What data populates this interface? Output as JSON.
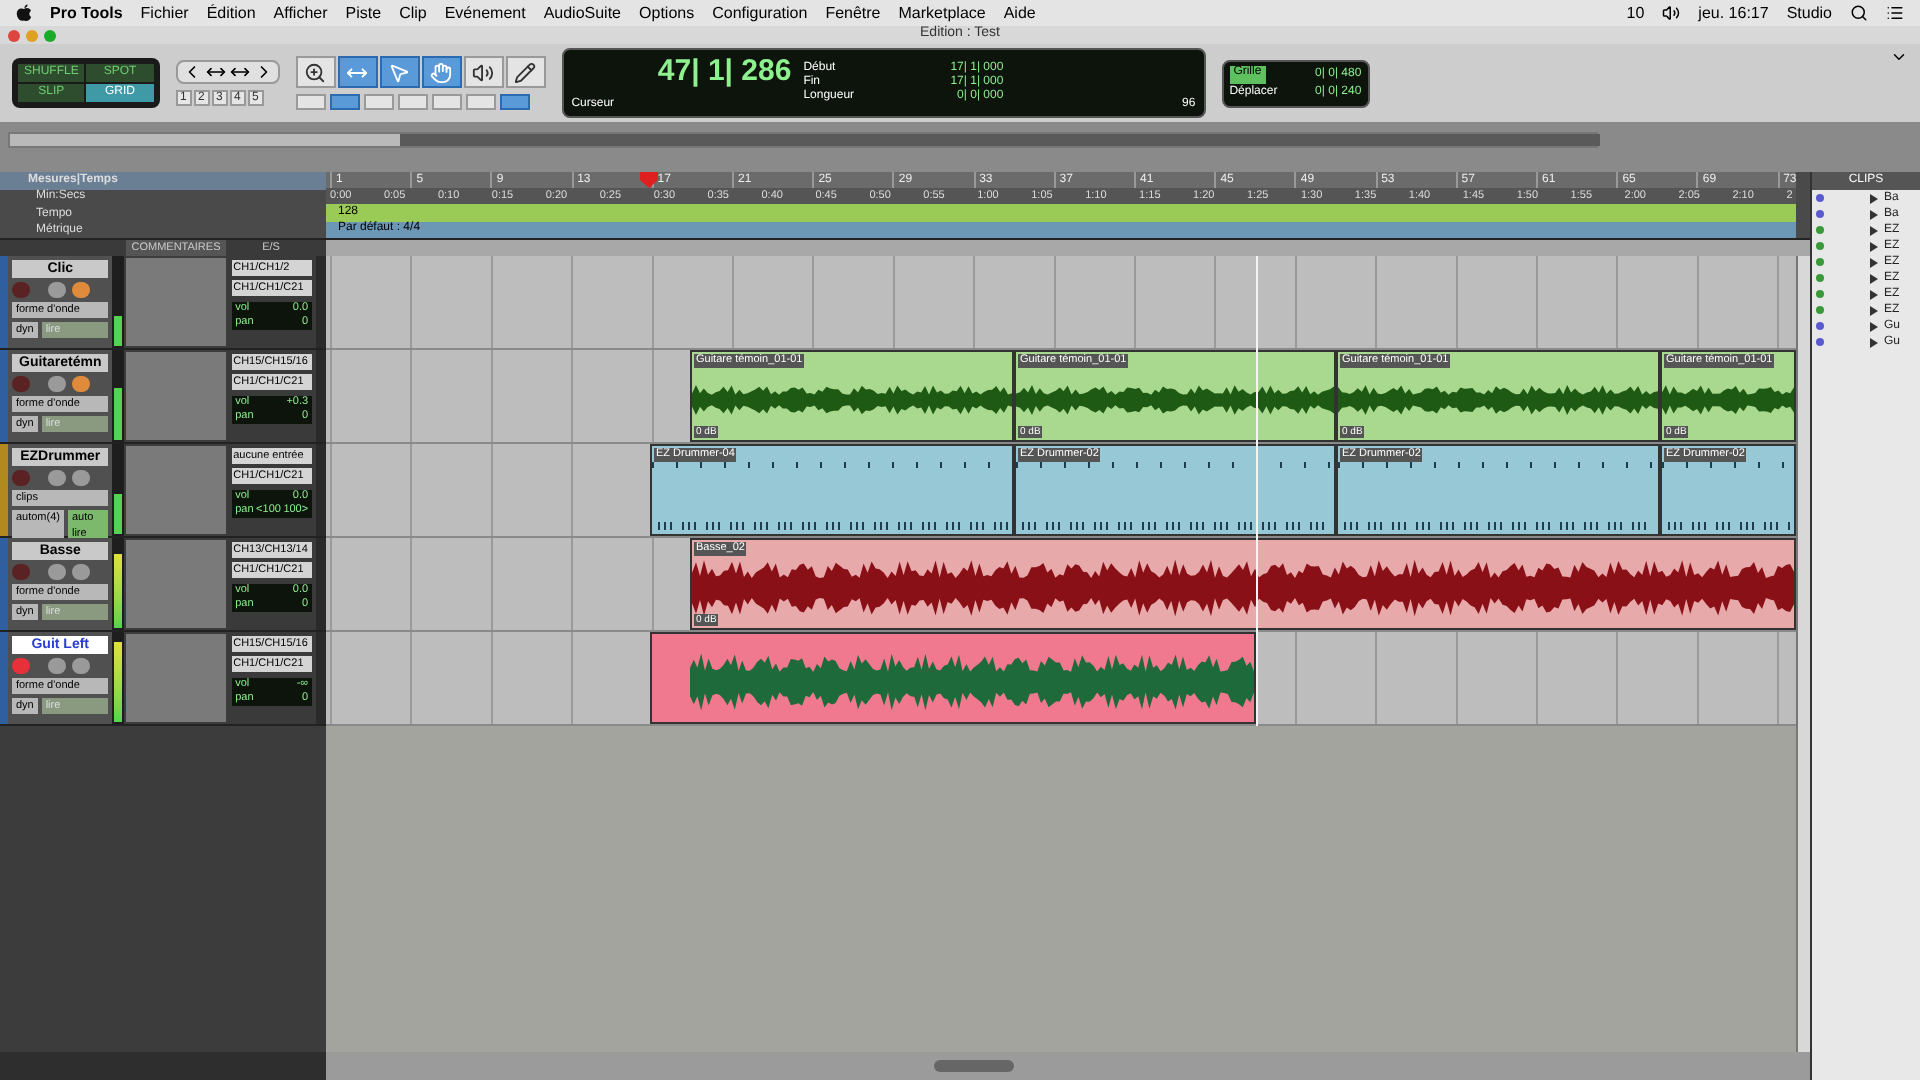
{
  "menubar": {
    "app": "Pro Tools",
    "menus": [
      "Fichier",
      "Édition",
      "Afficher",
      "Piste",
      "Clip",
      "Evénement",
      "AudioSuite",
      "Options",
      "Configuration",
      "Fenêtre",
      "Marketplace",
      "Aide"
    ],
    "status": [
      "10",
      "jeu. 16:17",
      "Studio"
    ]
  },
  "window": {
    "title": "Edition : Test"
  },
  "edit_modes": [
    {
      "label": "SHUFFLE",
      "selected": false
    },
    {
      "label": "SPOT",
      "selected": false
    },
    {
      "label": "SLIP",
      "selected": false
    },
    {
      "label": "GRID",
      "selected": true
    }
  ],
  "zoom_presets": [
    "1",
    "2",
    "3",
    "4",
    "5"
  ],
  "tools": [
    {
      "kind": "zoom",
      "selected": false
    },
    {
      "kind": "trim",
      "selected": true
    },
    {
      "kind": "select",
      "selected": true
    },
    {
      "kind": "grab",
      "selected": true
    },
    {
      "kind": "scrub",
      "selected": false
    },
    {
      "kind": "pencil",
      "selected": false
    }
  ],
  "counter": {
    "main": "47| 1| 286",
    "label": "Curseur",
    "fields": [
      {
        "label": "Début",
        "value": "17| 1| 000"
      },
      {
        "label": "Fin",
        "value": "17| 1| 000"
      },
      {
        "label": "Longueur",
        "value": "0| 0| 000"
      }
    ],
    "nudge": "96"
  },
  "grid": {
    "grid_label": "Grille",
    "grid_value": "0| 0| 480",
    "nudge_label": "Déplacer",
    "nudge_value": "0| 0| 240"
  },
  "rulers": {
    "labels": [
      "Mesures|Temps",
      "Min:Secs",
      "Tempo",
      "Métrique"
    ],
    "bars": [
      "1",
      "5",
      "9",
      "13",
      "17",
      "21",
      "25",
      "29",
      "33",
      "37",
      "41",
      "45",
      "49",
      "53",
      "57",
      "61",
      "65",
      "69",
      "73"
    ],
    "times": [
      "0:00",
      "0:05",
      "0:10",
      "0:15",
      "0:20",
      "0:25",
      "0:30",
      "0:35",
      "0:40",
      "0:45",
      "0:50",
      "0:55",
      "1:00",
      "1:05",
      "1:10",
      "1:15",
      "1:20",
      "1:25",
      "1:30",
      "1:35",
      "1:40",
      "1:45",
      "1:50",
      "1:55",
      "2:00",
      "2:05",
      "2:10",
      "2"
    ],
    "tempo": "128",
    "meter": "Par défaut : 4/4"
  },
  "track_columns": [
    "COMMENTAIRES",
    "E/S"
  ],
  "tracks": [
    {
      "name": "Clic",
      "kind": "audio",
      "selected": false,
      "color": "#2f5f9e",
      "muted": true,
      "record_enabled": false,
      "level": 0.35,
      "selectors": [
        "forme d'onde",
        "dyn",
        "lire"
      ],
      "input": "CH1/CH1/2",
      "output": "CH1/CH1/C21",
      "vol_label": "vol",
      "vol": "0.0",
      "pan_label": "pan",
      "pan": [
        "0"
      ]
    },
    {
      "name": "Guitaretémn",
      "kind": "audio",
      "selected": false,
      "color": "#2f5f9e",
      "muted": true,
      "record_enabled": false,
      "level": 0.6,
      "selectors": [
        "forme d'onde",
        "dyn",
        "lire"
      ],
      "input": "CH15/CH15/16",
      "output": "CH1/CH1/C21",
      "vol_label": "vol",
      "vol": "+0.3",
      "pan_label": "pan",
      "pan": [
        "0"
      ],
      "clips": [
        {
          "name": "Guitare témoin_01-01",
          "gain": "0 dB",
          "color": "#a9d98e"
        },
        {
          "name": "Guitare témoin_01-01",
          "gain": "0 dB",
          "color": "#a9d98e"
        },
        {
          "name": "Guitare témoin_01-01",
          "gain": "0 dB",
          "color": "#a9d98e"
        },
        {
          "name": "Guitare témoin_01-01",
          "gain": "0 dB",
          "color": "#a9d98e"
        }
      ]
    },
    {
      "name": "EZDrummer",
      "kind": "instrument",
      "selected": false,
      "color": "#b08a1e",
      "muted": false,
      "record_enabled": false,
      "level": 0.45,
      "selectors": [
        "clips",
        "autom(4)",
        "auto lire"
      ],
      "input": "aucune entrée",
      "output": "CH1/CH1/C21",
      "vol_label": "vol",
      "vol": "0.0",
      "pan_label": "pan",
      "pan": [
        "<100",
        "100>"
      ],
      "clips": [
        {
          "name": "EZ Drummer-04",
          "color": "#96c8d6"
        },
        {
          "name": "EZ Drummer-02",
          "color": "#96c8d6"
        },
        {
          "name": "EZ Drummer-02",
          "color": "#96c8d6"
        },
        {
          "name": "EZ Drummer-02",
          "color": "#96c8d6"
        }
      ]
    },
    {
      "name": "Basse",
      "kind": "audio",
      "selected": false,
      "color": "#2f5f9e",
      "muted": false,
      "record_enabled": false,
      "level": 0.85,
      "selectors": [
        "forme d'onde",
        "dyn",
        "lire"
      ],
      "input": "CH13/CH13/14",
      "output": "CH1/CH1/C21",
      "vol_label": "vol",
      "vol": "0.0",
      "pan_label": "pan",
      "pan": [
        "0"
      ],
      "clips": [
        {
          "name": "Basse_02",
          "gain": "0 dB",
          "color": "#e8a9ab"
        }
      ]
    },
    {
      "name": "Guit Left",
      "kind": "audio",
      "selected": true,
      "color": "#2f5f9e",
      "muted": false,
      "record_enabled": true,
      "level": 0.9,
      "selectors": [
        "forme d'onde",
        "dyn",
        "lire"
      ],
      "input": "CH15/CH15/16",
      "output": "CH1/CH1/C21",
      "vol_label": "vol",
      "vol": "-∞",
      "pan_label": "pan",
      "pan": [
        "0"
      ],
      "clips": [
        {
          "color": "#f0788f"
        }
      ]
    }
  ],
  "clips_panel": {
    "title": "CLIPS",
    "items": [
      "Ba",
      "Ba",
      "EZ",
      "EZ",
      "EZ",
      "EZ",
      "EZ",
      "EZ",
      "Gu",
      "Gu"
    ]
  }
}
